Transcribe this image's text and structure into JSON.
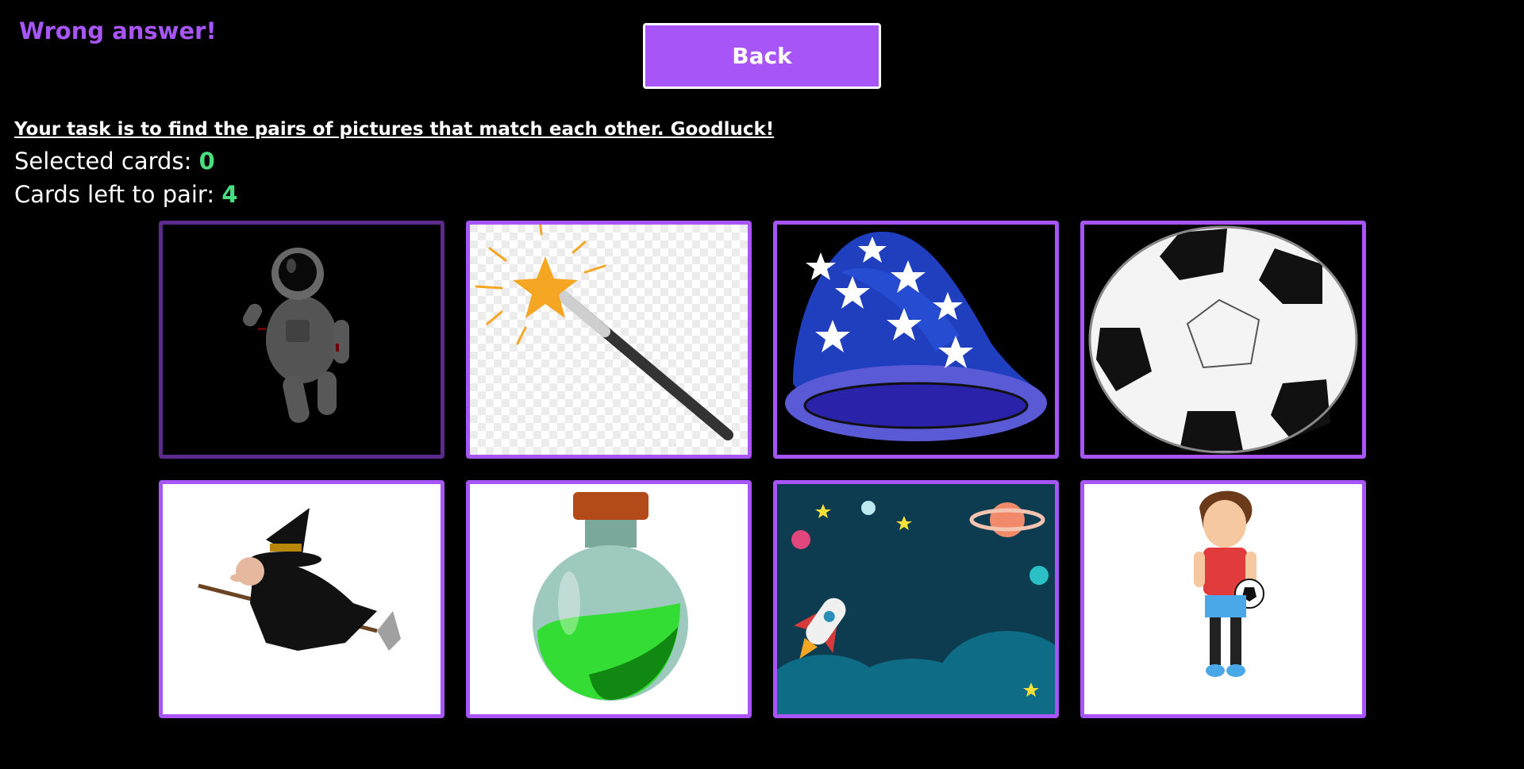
{
  "feedback": "Wrong answer!",
  "back_label": "Back",
  "instructions": "Your task is to find the pairs of pictures that match each other. Goodluck!",
  "stats": {
    "selected_label": "Selected cards: ",
    "selected_value": "0",
    "left_label": "Cards left to pair: ",
    "left_value": "4"
  },
  "cards": [
    {
      "picture": "astronaut",
      "state": "faded"
    },
    {
      "picture": "magic-wand",
      "state": "normal"
    },
    {
      "picture": "wizard-hat",
      "state": "normal"
    },
    {
      "picture": "soccer-ball",
      "state": "normal"
    },
    {
      "picture": "witch-on-broom",
      "state": "normal"
    },
    {
      "picture": "potion-bottle",
      "state": "normal"
    },
    {
      "picture": "space-scene",
      "state": "normal"
    },
    {
      "picture": "soccer-player-boy",
      "state": "normal"
    }
  ],
  "colors": {
    "accent": "#a855f7",
    "accent_dim": "#5b2a8c",
    "number": "#4ade80",
    "background": "#000000"
  }
}
